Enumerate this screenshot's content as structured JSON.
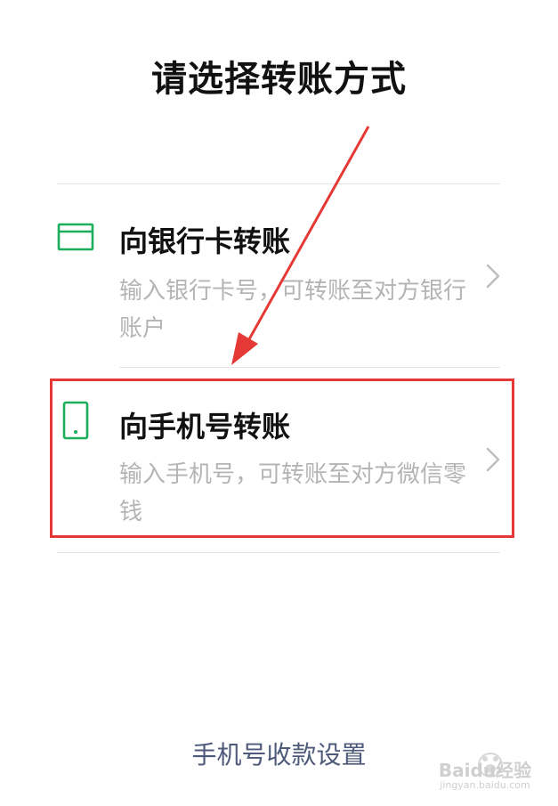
{
  "page": {
    "title": "请选择转账方式"
  },
  "options": [
    {
      "icon": "bank-card-icon",
      "label": "向银行卡转账",
      "description": "输入银行卡号，可转账至对方银行账户"
    },
    {
      "icon": "mobile-phone-icon",
      "label": "向手机号转账",
      "description": "输入手机号，可转账至对方微信零钱"
    }
  ],
  "footer": {
    "link_label": "手机号收款设置"
  },
  "watermark": {
    "icon": "baidu-jingyan-logo",
    "text": "Baidu经验",
    "url_text": "jingyan.baidu.com"
  },
  "colors": {
    "accent_green": "#1aad5a",
    "highlight_red": "#e53935",
    "link_blue": "#4e5a7a",
    "muted_text": "#b4b4b4"
  }
}
